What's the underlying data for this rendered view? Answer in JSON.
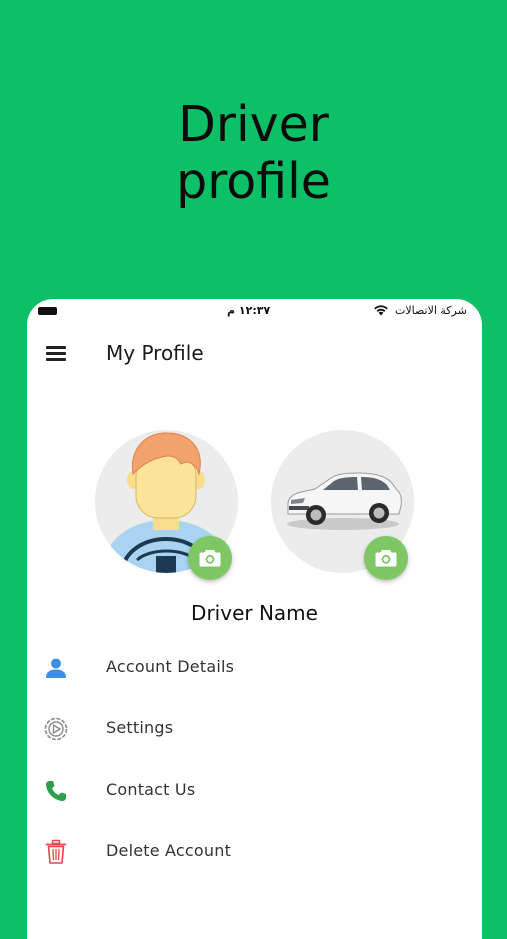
{
  "banner": {
    "line1": "Driver",
    "line2": "profile"
  },
  "status_bar": {
    "time": "١٢:٣٧ م",
    "carrier": "شركة الاتصالات"
  },
  "app_bar": {
    "title": "My Profile"
  },
  "profile": {
    "driver_name": "Driver Name"
  },
  "colors": {
    "background": "#0dbf66",
    "camera_button": "#7ec764",
    "account_icon": "#3b8fe0",
    "phone_icon": "#2e9d4d",
    "delete_icon": "#e04848"
  },
  "menu": [
    {
      "label": "Account Details",
      "icon": "person-icon"
    },
    {
      "label": "Settings",
      "icon": "settings-icon"
    },
    {
      "label": "Contact Us",
      "icon": "phone-icon"
    },
    {
      "label": "Delete Account",
      "icon": "trash-icon"
    }
  ]
}
